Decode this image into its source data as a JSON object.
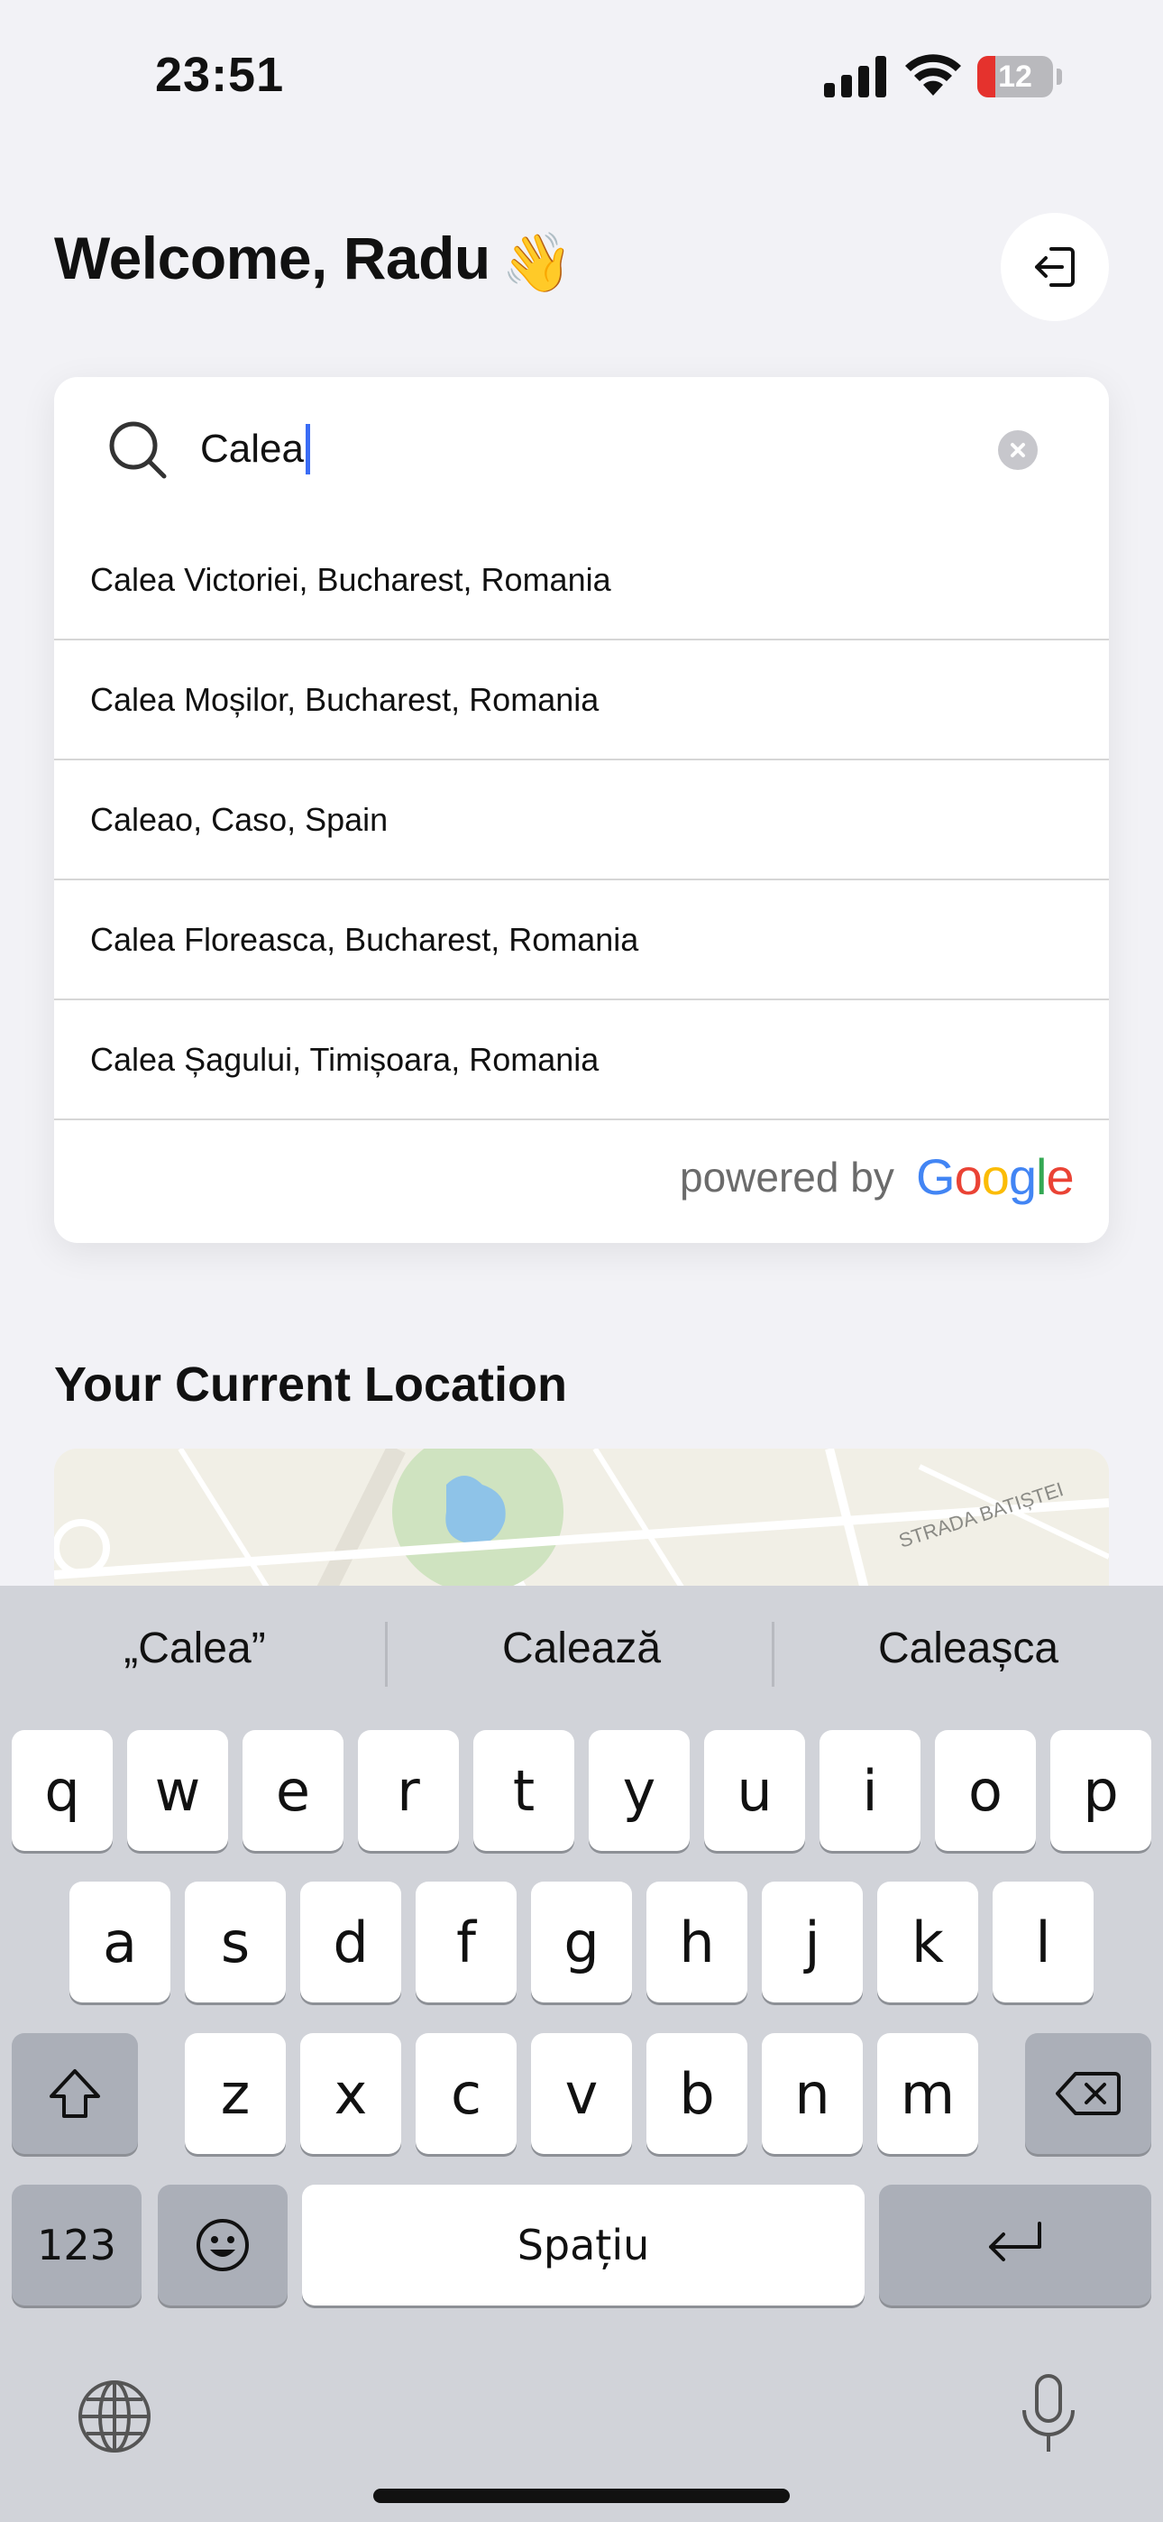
{
  "status_bar": {
    "time": "23:51",
    "battery": "12"
  },
  "header": {
    "welcome": "Welcome, Radu",
    "wave_emoji": "👋",
    "logout_icon": "logout-icon"
  },
  "search": {
    "value": "Calea",
    "suggestions": [
      "Calea Victoriei, Bucharest, Romania",
      "Calea Moșilor, Bucharest, Romania",
      "Caleao, Caso, Spain",
      "Calea Floreasca, Bucharest, Romania",
      "Calea Șagului, Timișoara, Romania"
    ],
    "powered_by": "powered by",
    "google": "Google"
  },
  "location": {
    "title": "Your Current Location",
    "map_label": "STRADA BATIȘTEI"
  },
  "keyboard": {
    "predictions": [
      "„Calea”",
      "Calează",
      "Caleașca"
    ],
    "row1": [
      "q",
      "w",
      "e",
      "r",
      "t",
      "y",
      "u",
      "i",
      "o",
      "p"
    ],
    "row2": [
      "a",
      "s",
      "d",
      "f",
      "g",
      "h",
      "j",
      "k",
      "l"
    ],
    "row3": [
      "z",
      "x",
      "c",
      "v",
      "b",
      "n",
      "m"
    ],
    "numbers_key": "123",
    "space": "Spațiu"
  },
  "colors": {
    "cursor": "#3a6cf5",
    "google_blue": "#4285F4",
    "google_red": "#EA4335",
    "google_yellow": "#FBBC05",
    "google_green": "#34A853"
  }
}
